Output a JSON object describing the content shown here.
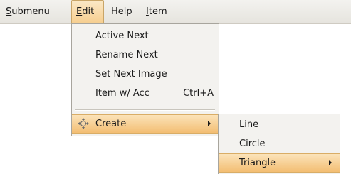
{
  "menubar": {
    "items": [
      {
        "label": "Submenu",
        "mnemonic": "S",
        "rest": "ubmenu"
      },
      {
        "label": "Edit",
        "mnemonic": "E",
        "rest": "dit",
        "active": true
      },
      {
        "label": "Help",
        "mnemonic": "",
        "rest": "Help"
      },
      {
        "label": "Item",
        "mnemonic": "I",
        "rest": "tem"
      }
    ]
  },
  "edit_menu": {
    "items": [
      {
        "label": "Active Next"
      },
      {
        "label": "Rename Next"
      },
      {
        "label": "Set Next Image"
      },
      {
        "label": "Item w/ Acc",
        "accel": "Ctrl+A"
      },
      {
        "label": "Create",
        "icon": "crosshair-move-icon",
        "submenu": true,
        "highlighted": true
      }
    ]
  },
  "create_submenu": {
    "items": [
      {
        "label": "Line"
      },
      {
        "label": "Circle"
      },
      {
        "label": "Triangle",
        "submenu": true,
        "highlighted": true
      }
    ]
  },
  "colors": {
    "highlight": "#f3be73",
    "menu_bg": "#f3f2ef"
  }
}
